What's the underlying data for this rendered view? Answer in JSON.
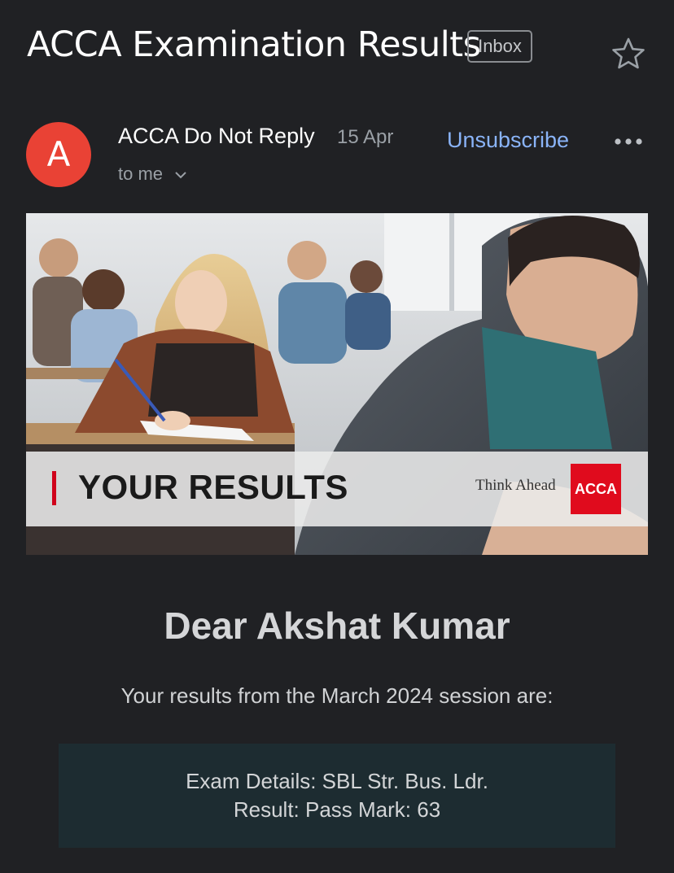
{
  "header": {
    "subject": "ACCA Examination Results",
    "label": "Inbox",
    "star_icon": "star-outline-icon"
  },
  "message": {
    "avatar_letter": "A",
    "sender_name": "ACCA Do Not Reply",
    "date": "15 Apr",
    "recipient_text": "to me",
    "unsubscribe_label": "Unsubscribe",
    "more_icon": "more-horizontal-icon"
  },
  "banner": {
    "title": "YOUR RESULTS",
    "tagline": "Think Ahead",
    "logo_text": "ACCA"
  },
  "body": {
    "greeting": "Dear Akshat Kumar",
    "intro": "Your results from the March 2024 session are:",
    "exam_details": "Exam Details: SBL Str. Bus. Ldr.",
    "result": "Result: Pass Mark: 63"
  },
  "colors": {
    "background": "#202124",
    "avatar": "#e94235",
    "link": "#8ab4f8",
    "result_box": "#1d2c31",
    "acca_red": "#e00b1d"
  }
}
